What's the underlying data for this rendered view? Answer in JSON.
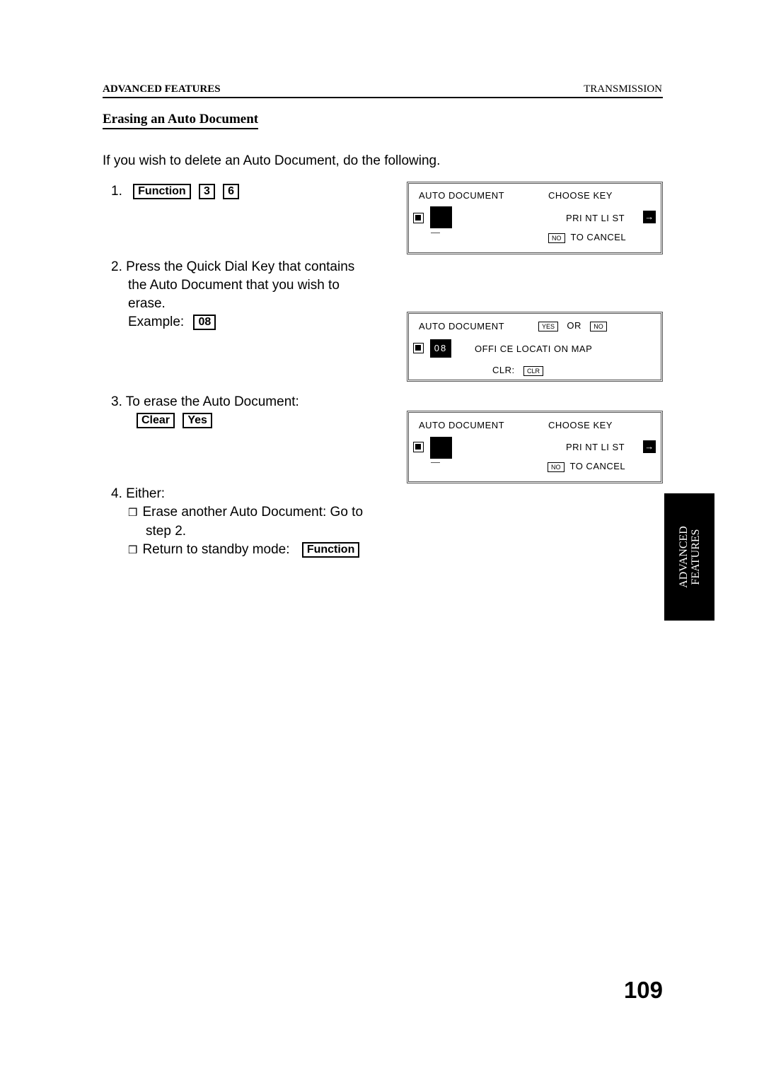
{
  "header": {
    "section": "ADVANCED FEATURES",
    "chapter": "TRANSMISSION"
  },
  "title": "Erasing an Auto Document",
  "intro": "If you wish to delete an Auto Document, do the following.",
  "steps": [
    {
      "num": "1.",
      "keys": [
        "Function",
        "3",
        "6"
      ]
    },
    {
      "num": "2.",
      "lines": [
        "Press the Quick Dial Key that contains",
        "the Auto Document that you wish to",
        "erase."
      ],
      "example_label": "Example:",
      "example_key": "08"
    },
    {
      "num": "3.",
      "text": "To erase the Auto Document:",
      "keys": [
        "Clear",
        "Yes"
      ]
    },
    {
      "num": "4.",
      "text": "Either:",
      "options": [
        {
          "lines": [
            "Erase another Auto Document: Go to",
            "step 2."
          ]
        },
        {
          "text": "Return to standby mode:",
          "key": "Function"
        }
      ]
    }
  ],
  "displays": [
    {
      "line1_left": "AUTO DOCUMENT",
      "line1_right": "CHOOSE KEY",
      "line2_right": "PRI NT LI ST",
      "line2_arrow": "→",
      "line3_key": "NO",
      "line3_text": "TO CANCEL"
    },
    {
      "line1_left": "AUTO DOCUMENT",
      "line1_yes": "YES",
      "line1_or": "OR",
      "line1_no": "NO",
      "line2_num": "08",
      "line2_text": "OFFI CE LOCATI ON MAP",
      "line3_label": "CLR:",
      "line3_key": "CLR"
    },
    {
      "line1_left": "AUTO DOCUMENT",
      "line1_right": "CHOOSE KEY",
      "line2_right": "PRI NT LI ST",
      "line2_arrow": "→",
      "line3_key": "NO",
      "line3_text": "TO CANCEL"
    }
  ],
  "side_tab": [
    "ADVANCED",
    "FEATURES"
  ],
  "bullet_glyph": "❒",
  "page_number": "109"
}
